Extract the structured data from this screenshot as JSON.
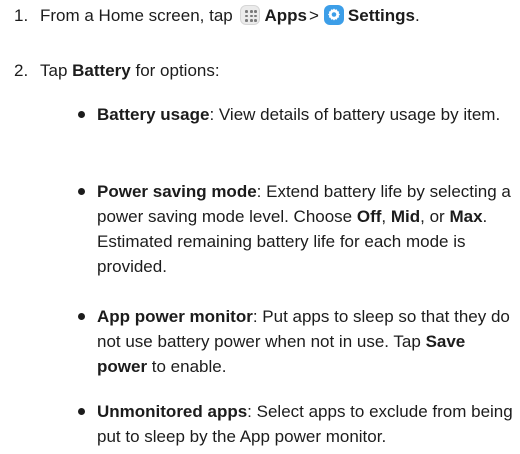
{
  "steps": [
    {
      "number": "1.",
      "prefix": "From a Home screen, tap",
      "apps_label": "Apps",
      "separator": ">",
      "settings_label": "Settings",
      "suffix": ".",
      "icons": [
        "apps-grid-icon",
        "settings-gear-icon"
      ]
    },
    {
      "number": "2.",
      "prefix": "Tap",
      "bold": "Battery",
      "suffix": " for options:"
    }
  ],
  "bullets": [
    {
      "term": "Battery usage",
      "text": ": View details of battery usage by item."
    },
    {
      "term": "Power saving mode",
      "text": ": Extend battery life by selecting a power saving mode level. Choose ",
      "opt1": "Off",
      "sep1": ", ",
      "opt2": "Mid",
      "sep2": ", or ",
      "opt3": "Max",
      "tail": ". Estimated remaining battery life for each mode is provided."
    },
    {
      "term": "App power monitor",
      "text": ": Put apps to sleep so that they do not use battery power when not in use. Tap ",
      "bold2": "Save power",
      "tail": " to enable."
    },
    {
      "term": "Unmonitored apps",
      "text": ": Select apps to exclude from being put to sleep by the App power monitor."
    }
  ],
  "colors": {
    "text": "#1c1c1c",
    "settings_icon": "#3c9ee8",
    "apps_icon": "#ebebeb"
  }
}
